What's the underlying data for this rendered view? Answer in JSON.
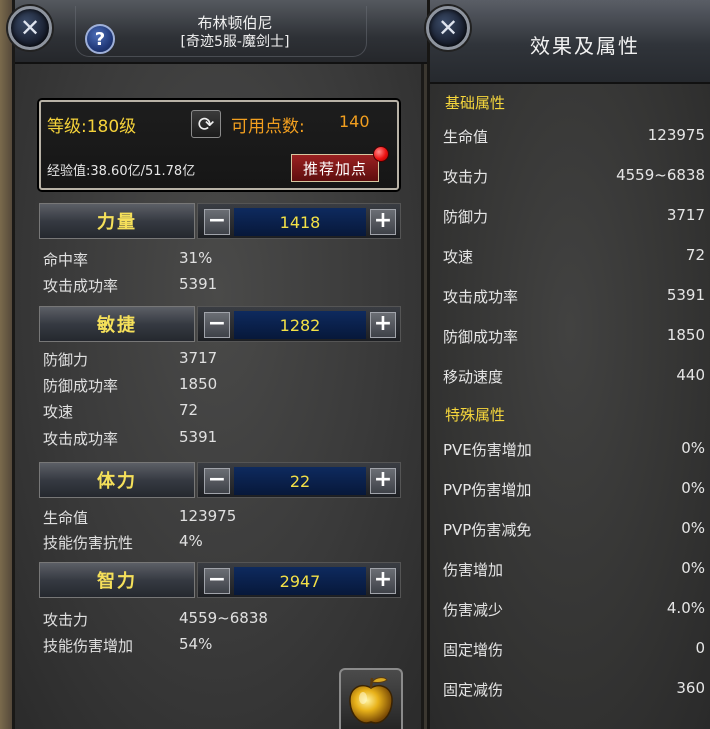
{
  "left_panel": {
    "character_name": "布林顿伯尼",
    "server_class": "[奇迹5服-魔剑士]",
    "level_label": "等级:180级",
    "available_points_label": "可用点数:",
    "available_points_value": "140",
    "experience_label": "经验值:38.60亿/51.78亿",
    "recommend_button_label": "推荐加点",
    "stats": [
      {
        "name": "力量",
        "value": "1418",
        "details": [
          {
            "label": "命中率",
            "value": "31%"
          },
          {
            "label": "攻击成功率",
            "value": "5391"
          }
        ]
      },
      {
        "name": "敏捷",
        "value": "1282",
        "details": [
          {
            "label": "防御力",
            "value": "3717"
          },
          {
            "label": "防御成功率",
            "value": "1850"
          },
          {
            "label": "攻速",
            "value": "72"
          },
          {
            "label": "攻击成功率",
            "value": "5391"
          }
        ]
      },
      {
        "name": "体力",
        "value": "22",
        "details": [
          {
            "label": "生命值",
            "value": "123975"
          },
          {
            "label": "技能伤害抗性",
            "value": "4%"
          }
        ]
      },
      {
        "name": "智力",
        "value": "2947",
        "details": [
          {
            "label": "攻击力",
            "value": "4559~6838"
          },
          {
            "label": "技能伤害增加",
            "value": "54%"
          }
        ]
      }
    ],
    "minus_label": "−",
    "plus_label": "+"
  },
  "right_panel": {
    "title": "效果及属性",
    "basic_title": "基础属性",
    "basic_attrs": [
      {
        "label": "生命值",
        "value": "123975"
      },
      {
        "label": "攻击力",
        "value": "4559~6838"
      },
      {
        "label": "防御力",
        "value": "3717"
      },
      {
        "label": "攻速",
        "value": "72"
      },
      {
        "label": "攻击成功率",
        "value": "5391"
      },
      {
        "label": "防御成功率",
        "value": "1850"
      },
      {
        "label": "移动速度",
        "value": "440"
      }
    ],
    "special_title": "特殊属性",
    "special_attrs": [
      {
        "label": "PVE伤害增加",
        "value": "0%"
      },
      {
        "label": "PVP伤害增加",
        "value": "0%"
      },
      {
        "label": "PVP伤害减免",
        "value": "0%"
      },
      {
        "label": "伤害增加",
        "value": "0%"
      },
      {
        "label": "伤害减少",
        "value": "4.0%"
      },
      {
        "label": "固定增伤",
        "value": "0"
      },
      {
        "label": "固定减伤",
        "value": "360"
      }
    ]
  },
  "icons": {
    "close": "close-icon",
    "help": "help-icon",
    "refresh": "refresh-icon",
    "apple": "golden-apple-icon"
  },
  "colors": {
    "gold_text": "#f5d63c",
    "orange_text": "#f29f1f",
    "value_blue": "#0e2a5e",
    "recommend_red": "#9a2121"
  }
}
